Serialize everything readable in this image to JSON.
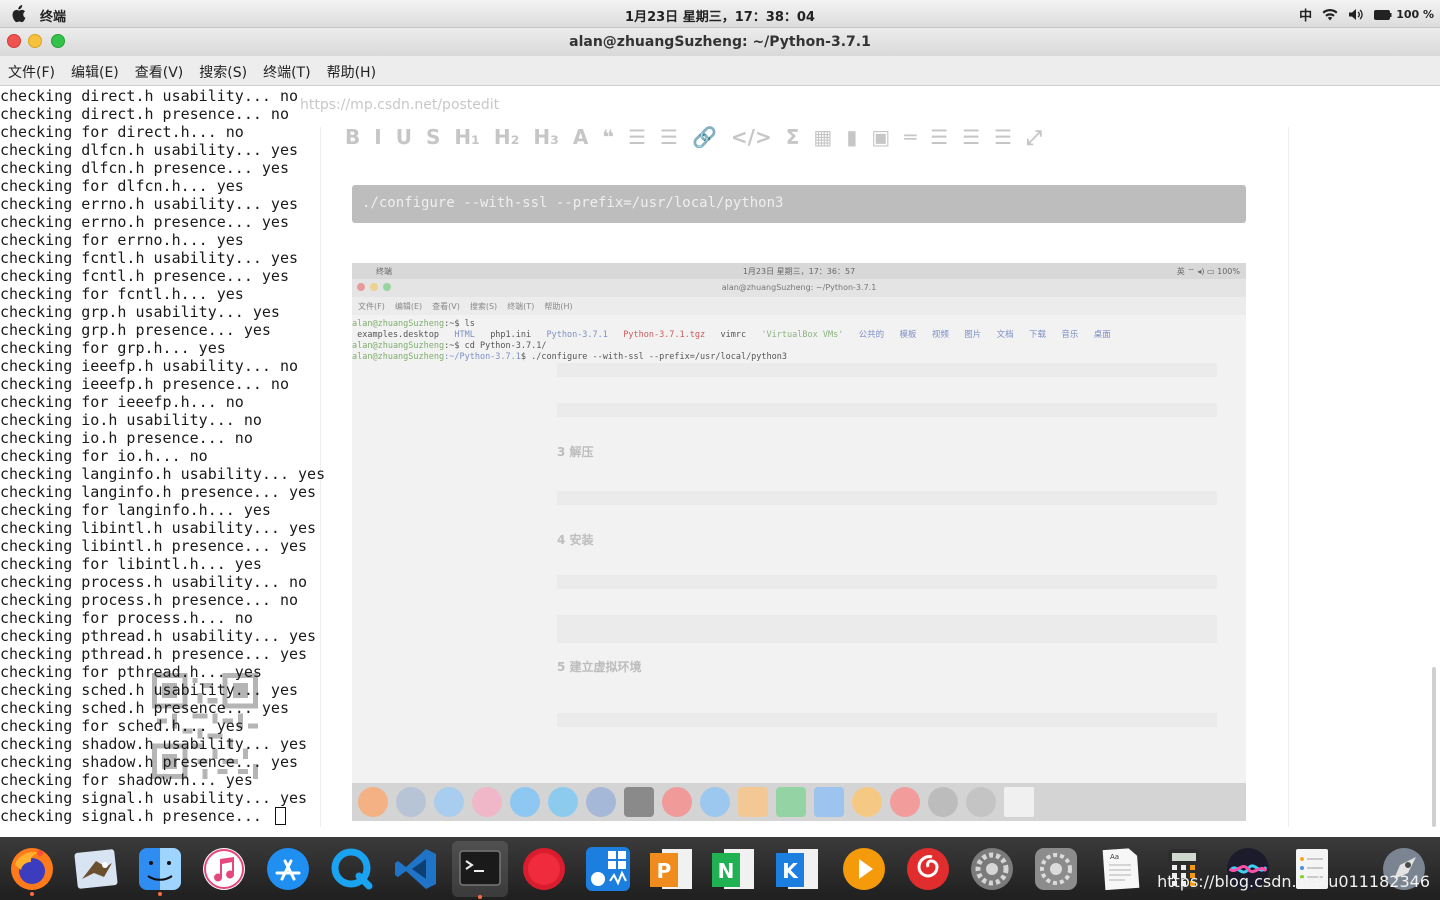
{
  "topbar": {
    "app_name": "终端",
    "clock": "1月23日 星期三，17：38：04",
    "ime": "中",
    "battery": "100 %"
  },
  "window": {
    "title": "alan@zhuangSuzheng: ~/Python-3.7.1"
  },
  "menu": [
    "文件(F)",
    "编辑(E)",
    "查看(V)",
    "搜索(S)",
    "终端(T)",
    "帮助(H)"
  ],
  "terminal_lines": [
    "checking direct.h usability... no",
    "checking direct.h presence... no",
    "checking for direct.h... no",
    "checking dlfcn.h usability... yes",
    "checking dlfcn.h presence... yes",
    "checking for dlfcn.h... yes",
    "checking errno.h usability... yes",
    "checking errno.h presence... yes",
    "checking for errno.h... yes",
    "checking fcntl.h usability... yes",
    "checking fcntl.h presence... yes",
    "checking for fcntl.h... yes",
    "checking grp.h usability... yes",
    "checking grp.h presence... yes",
    "checking for grp.h... yes",
    "checking ieeefp.h usability... no",
    "checking ieeefp.h presence... no",
    "checking for ieeefp.h... no",
    "checking io.h usability... no",
    "checking io.h presence... no",
    "checking for io.h... no",
    "checking langinfo.h usability... yes",
    "checking langinfo.h presence... yes",
    "checking for langinfo.h... yes",
    "checking libintl.h usability... yes",
    "checking libintl.h presence... yes",
    "checking for libintl.h... yes",
    "checking process.h usability... no",
    "checking process.h presence... no",
    "checking for process.h... no",
    "checking pthread.h usability... yes",
    "checking pthread.h presence... yes",
    "checking for pthread.h... yes",
    "checking sched.h usability... yes",
    "checking sched.h presence... yes",
    "checking for sched.h... yes",
    "checking shadow.h usability... yes",
    "checking shadow.h presence... yes",
    "checking for shadow.h... yes",
    "checking signal.h usability... yes",
    "checking signal.h presence... "
  ],
  "ghost": {
    "url": "https://mp.csdn.net/postedit",
    "toolbar": [
      "B",
      "I",
      "U",
      "S",
      "H₁",
      "H₂",
      "H₃",
      "A",
      "❝",
      "☰",
      "☰",
      "🔗",
      "</>",
      "Σ",
      "▦",
      "▮",
      "▣",
      "═",
      "☰",
      "☰",
      "☰",
      "⤢"
    ]
  },
  "code_block": "./configure --with-ssl --prefix=/usr/local/python3",
  "embedded": {
    "app_name": "终端",
    "clock": "1月23日 星期三，17：36：57",
    "tray": "英 ⌔ ◂) ▭ 100%",
    "title": "alan@zhuangSuzheng: ~/Python-3.7.1",
    "menu": [
      "文件(F)",
      "编辑(E)",
      "查看(V)",
      "搜索(S)",
      "终端(T)",
      "帮助(H)"
    ],
    "prompt_user": "alan@zhuangSuzheng",
    "prompt_home": ":~$",
    "prompt_dir": ":~/Python-3.7.1",
    "prompt_dir_end": "$",
    "cmd_ls": " ls",
    "ls_items": [
      " examples.desktop   ",
      "HTML   ",
      "php1.ini   ",
      "Python-3.7.1   ",
      "Python-3.7.1.tgz   ",
      "vimrc   ",
      "'VirtualBox VMs'   ",
      "公共的   ",
      "模板   ",
      "视频   ",
      "图片   ",
      "文档   ",
      "下载   ",
      "音乐   ",
      "桌面"
    ],
    "cmd_cd": " cd Python-3.7.1/",
    "cmd_configure": " ./configure --with-ssl --prefix=/usr/local/python3",
    "headings": [
      "3 解压",
      "4 安装",
      "5 建立虚拟环境"
    ]
  },
  "watermark": "https://blog.csdn.net/u011182346"
}
